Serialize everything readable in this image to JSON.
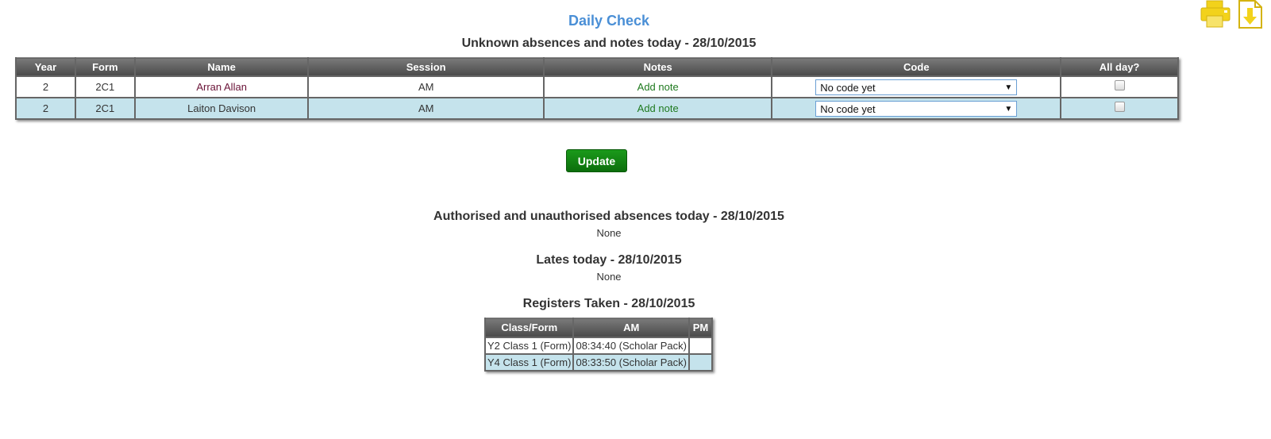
{
  "page": {
    "title": "Daily Check"
  },
  "toolbar": {
    "print_icon": "printer-icon",
    "export_icon": "download-document-icon"
  },
  "unknown_absences": {
    "heading": "Unknown absences and notes today - 28/10/2015",
    "columns": [
      "Year",
      "Form",
      "Name",
      "Session",
      "Notes",
      "Code",
      "All day?"
    ],
    "rows": [
      {
        "year": "2",
        "form": "2C1",
        "name": "Arran Allan",
        "session": "AM",
        "notes": "Add note",
        "code": "No code yet",
        "all_day": false
      },
      {
        "year": "2",
        "form": "2C1",
        "name": "Laiton Davison",
        "session": "AM",
        "notes": "Add note",
        "code": "No code yet",
        "all_day": false
      }
    ]
  },
  "update_button": {
    "label": "Update"
  },
  "authorised_absences": {
    "heading": "Authorised and unauthorised absences today - 28/10/2015",
    "value": "None"
  },
  "lates": {
    "heading": "Lates today - 28/10/2015",
    "value": "None"
  },
  "registers": {
    "heading": "Registers Taken - 28/10/2015",
    "columns": [
      "Class/Form",
      "AM",
      "PM"
    ],
    "rows": [
      {
        "class_form": "Y2 Class 1 (Form)",
        "am": "08:34:40 (Scholar Pack)",
        "pm": ""
      },
      {
        "class_form": "Y4 Class 1 (Form)",
        "am": "08:33:50 (Scholar Pack)",
        "pm": ""
      }
    ]
  },
  "colors": {
    "title": "#4a8fd6",
    "header_bg": "#5a5a5a",
    "row_alt": "#c5e3ec",
    "update_button": "#138413",
    "note_link": "#1f7a1f",
    "name_link": "#6b1438",
    "icon_yellow": "#f2d21b"
  }
}
